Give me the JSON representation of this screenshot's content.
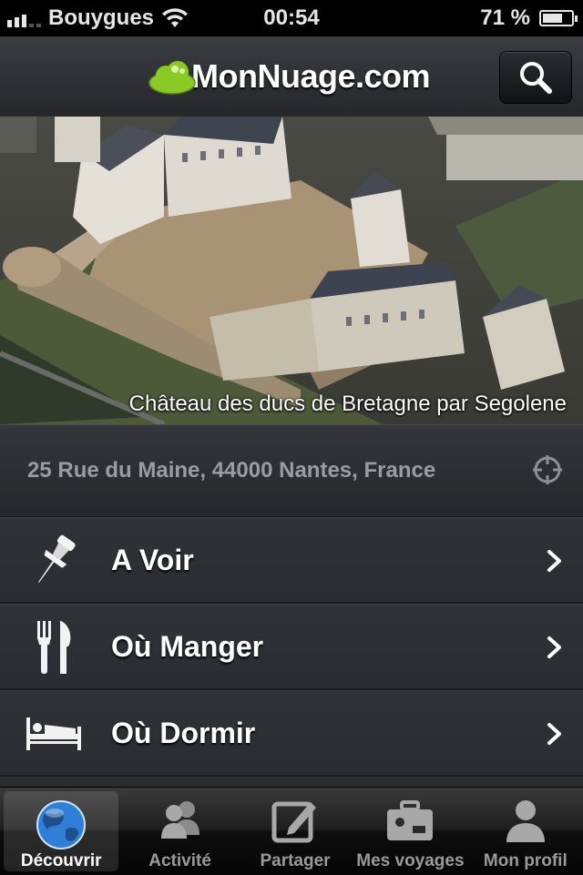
{
  "status_bar": {
    "carrier": "Bouygues",
    "time": "00:54",
    "battery": "71 %",
    "battery_level": 0.71
  },
  "header": {
    "logo_text": "MonNuage.com",
    "search_icon": "search-icon"
  },
  "photo": {
    "caption": "Château des ducs de Bretagne par Segolene"
  },
  "address": {
    "text": "25 Rue du Maine, 44000 Nantes, France",
    "icon": "locate-icon"
  },
  "menu": {
    "items": [
      {
        "label": "A Voir",
        "icon": "pushpin-icon"
      },
      {
        "label": "Où Manger",
        "icon": "fork-knife-icon"
      },
      {
        "label": "Où Dormir",
        "icon": "bed-icon"
      }
    ]
  },
  "tabbar": {
    "tabs": [
      {
        "label": "Découvrir",
        "icon": "globe-icon",
        "active": true
      },
      {
        "label": "Activité",
        "icon": "users-icon"
      },
      {
        "label": "Partager",
        "icon": "compose-icon"
      },
      {
        "label": "Mes voyages",
        "icon": "suitcase-icon"
      },
      {
        "label": "Mon profil",
        "icon": "user-icon"
      }
    ]
  },
  "colors": {
    "logo_cloud": "#8ac926",
    "active_tab_globe": "#2f7fd8"
  }
}
